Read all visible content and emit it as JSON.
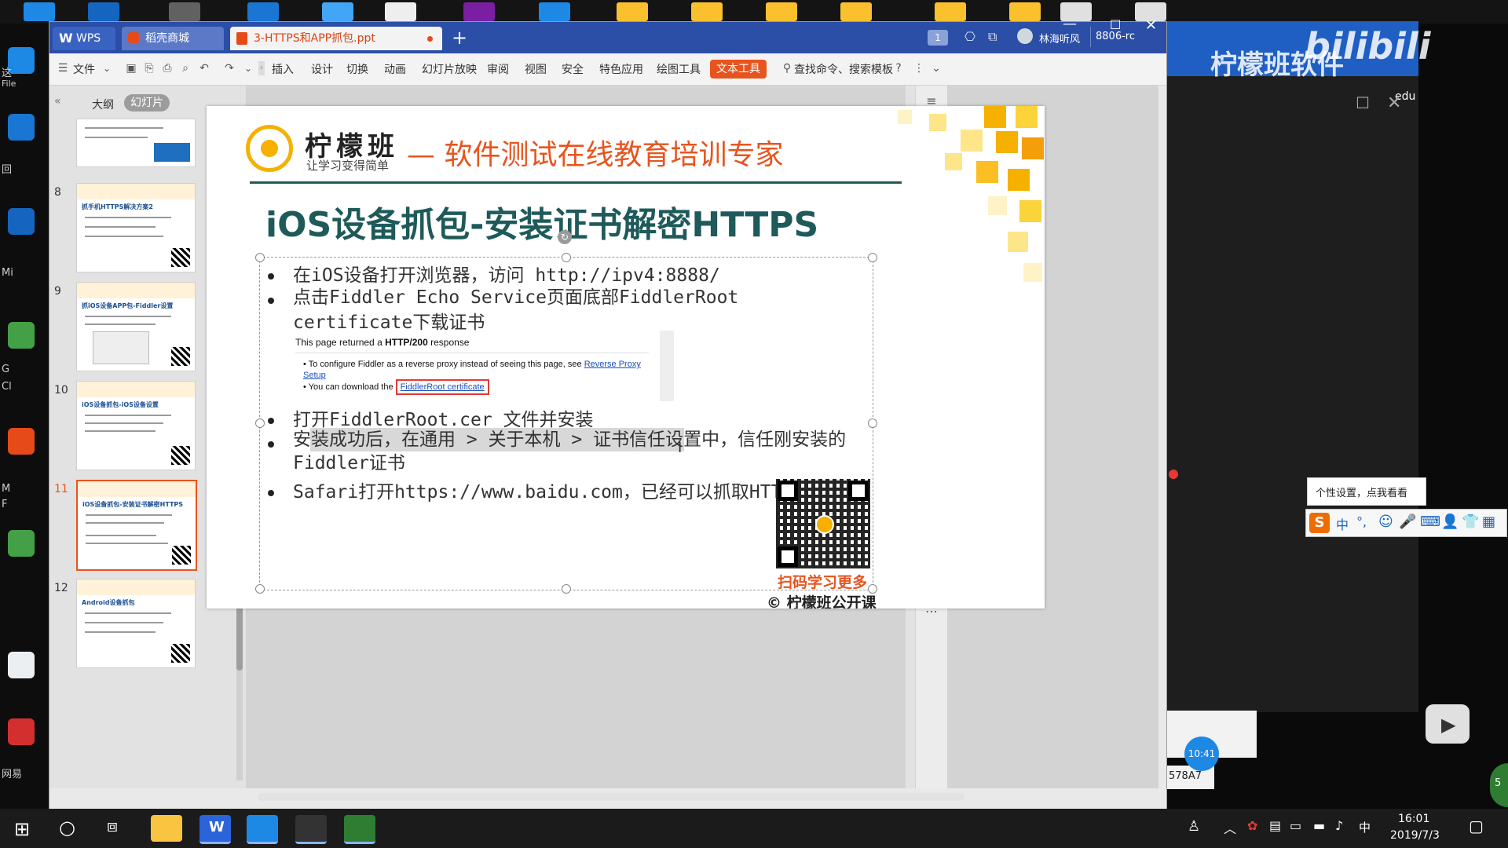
{
  "desktop": {
    "left_labels": [
      "这",
      "File",
      "回",
      "Mi",
      "G",
      "Cl",
      "M",
      "F",
      "网易"
    ],
    "watermark": "柠檬班软件",
    "bilibili_mark": "bilibili",
    "edu_label": "edu",
    "tooltip_text": "个性设置，点我看看",
    "ime_label": "中",
    "clock_badge": "10:41",
    "side_number": "5",
    "partial_text": "578A7"
  },
  "wps": {
    "tabs": [
      {
        "label": "WPS",
        "active": false
      },
      {
        "label": "稻壳商城",
        "active": false
      },
      {
        "label": "3-HTTPS和APP抓包.ppt",
        "active": true
      }
    ],
    "user_name": "林海听风",
    "user_id": "8806-rc",
    "page_badge": "1",
    "file_menu": "文件",
    "menu_items": [
      "插入",
      "设计",
      "切换",
      "动画",
      "幻灯片放映",
      "审阅",
      "视图",
      "安全",
      "特色应用",
      "绘图工具"
    ],
    "active_tool": "文本工具",
    "search_label": "查找命令、搜索模板",
    "panel_tabs": [
      "大纲",
      "幻灯片"
    ],
    "thumbnails": [
      {
        "num": "8",
        "title": "抓手机HTTPS解决方案2"
      },
      {
        "num": "9",
        "title": "抓iOS设备APP包-Fiddler设置"
      },
      {
        "num": "10",
        "title": "iOS设备抓包-iOS设备设置"
      },
      {
        "num": "11",
        "title": "iOS设备抓包-安装证书解密HTTPS",
        "selected": true
      },
      {
        "num": "12",
        "title": "Android设备抓包"
      }
    ]
  },
  "slide": {
    "logo_name": "柠檬班",
    "logo_sub": "让学习变得简单",
    "tagline": "— 软件测试在线教育培训专家",
    "title": "iOS设备抓包-安装证书解密HTTPS",
    "bullets": [
      "在iOS设备打开浏览器，访问 http://ipv4:8888/",
      "点击Fiddler Echo Service页面底部FiddlerRoot certificate下载证书",
      "打开FiddlerRoot.cer 文件并安装",
      "安装成功后，在通用 > 关于本机 > 证书信任设置中，信任刚安装的Fiddler证书",
      "Safari打开https://www.baidu.com，已经可以抓取HTTPS包了"
    ],
    "screenshot": {
      "line1_prefix": "This page returned a ",
      "line1_bold": "HTTP/200",
      "line1_suffix": " response",
      "bullet1_text": "To configure Fiddler as a reverse proxy instead of seeing this page, see ",
      "bullet1_link": "Reverse Proxy Setup",
      "bullet2_text": "You can download the ",
      "bullet2_link": "FiddlerRoot certificate"
    },
    "qr_caption": "扫码学习更多",
    "footer": "© 柠檬班公开课"
  },
  "taskbar": {
    "time": "16:01",
    "date": "2019/7/3",
    "ime": "中"
  }
}
